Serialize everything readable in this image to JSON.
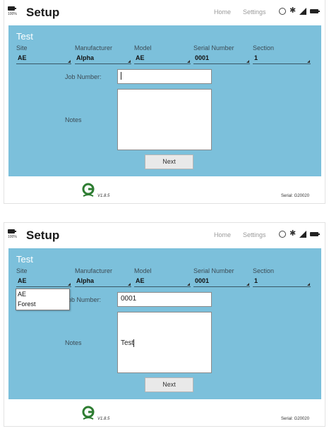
{
  "screens": [
    {
      "battery_pct": "100%",
      "title": "Setup",
      "nav": {
        "home": "Home",
        "settings": "Settings"
      },
      "panel_title": "Test",
      "headers": {
        "site": "Site",
        "manufacturer": "Manufacturer",
        "model": "Model",
        "serial_number": "Serial Number",
        "section": "Section"
      },
      "selects": {
        "site": "AE",
        "manufacturer": "Alpha",
        "model": "AE",
        "serial_number": "0001",
        "section": "1"
      },
      "job_number_label": "Job Number:",
      "job_number_value": "",
      "notes_label": "Notes",
      "notes_value": "",
      "next_label": "Next",
      "version": "V1.8.5",
      "serial": "Serial: G20020"
    },
    {
      "battery_pct": "100%",
      "title": "Setup",
      "nav": {
        "home": "Home",
        "settings": "Settings"
      },
      "panel_title": "Test",
      "headers": {
        "site": "Site",
        "manufacturer": "Manufacturer",
        "model": "Model",
        "serial_number": "Serial Number",
        "section": "Section"
      },
      "selects": {
        "site": "AE",
        "manufacturer": "Alpha",
        "model": "AE",
        "serial_number": "0001",
        "section": "1"
      },
      "site_dropdown_options": [
        "AE",
        "Forest"
      ],
      "job_number_label": "Job Number:",
      "job_number_label_visible": "ob Number:",
      "job_number_value": "0001",
      "notes_label": "Notes",
      "notes_value": "Test",
      "next_label": "Next",
      "version": "V1.8.5",
      "serial": "Serial: G20020"
    }
  ],
  "colors": {
    "panel": "#7cc0db",
    "panel_title": "#ffffff",
    "label": "#3c4b55",
    "logo_green": "#2e7d32"
  }
}
